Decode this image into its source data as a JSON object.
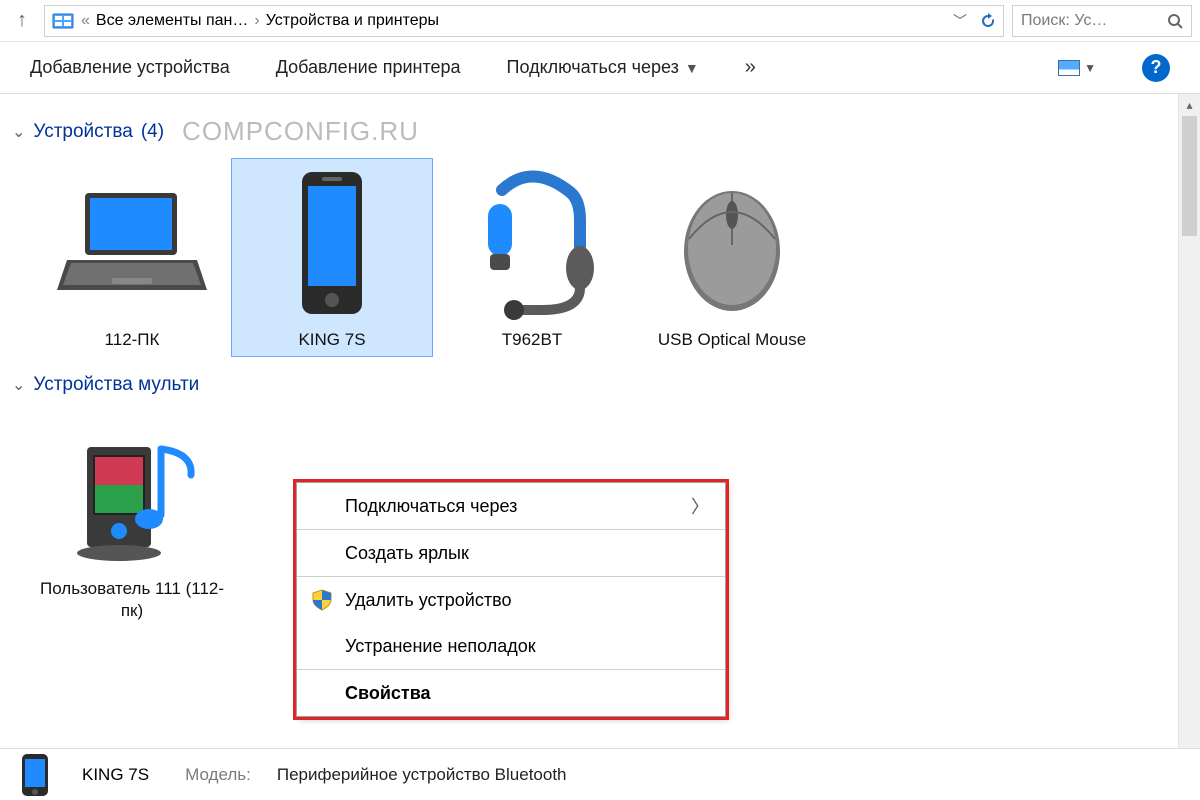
{
  "breadcrumb": {
    "parent": "Все элементы пан…",
    "current": "Устройства и принтеры"
  },
  "search": {
    "placeholder": "Поиск: Ус…"
  },
  "toolbar": {
    "add_device": "Добавление устройства",
    "add_printer": "Добавление принтера",
    "connect_via": "Подключаться через",
    "overflow_glyph": "»"
  },
  "groups": {
    "devices": {
      "title": "Устройства",
      "count": "(4)"
    },
    "multimedia": {
      "title": "Устройства мульти"
    }
  },
  "watermark": "COMPCONFIG.RU",
  "devices": [
    {
      "label": "112-ПК"
    },
    {
      "label": "KING 7S"
    },
    {
      "label": "T962BT"
    },
    {
      "label": "USB Optical Mouse"
    }
  ],
  "multimedia": [
    {
      "label": "Пользователь 111 (112-пк)"
    }
  ],
  "context_menu": {
    "connect_via": "Подключаться через",
    "create_shortcut": "Создать ярлык",
    "delete_device": "Удалить устройство",
    "troubleshoot": "Устранение неполадок",
    "properties": "Свойства"
  },
  "status": {
    "name": "KING 7S",
    "model_label": "Модель:",
    "model_value": "Периферийное устройство Bluetooth"
  }
}
